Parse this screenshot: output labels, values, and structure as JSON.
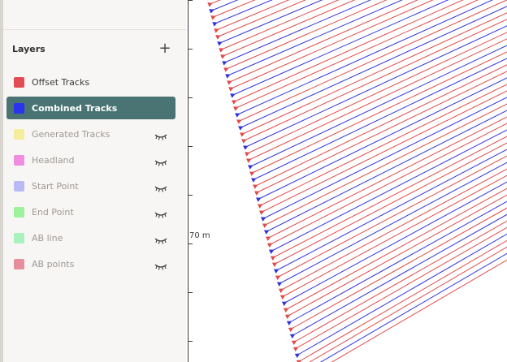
{
  "sidebar": {
    "title": "Layers",
    "add_label": "+",
    "items": [
      {
        "label": "Offset Tracks",
        "color": "#e34b55",
        "selected": false,
        "hidden": false
      },
      {
        "label": "Combined Tracks",
        "color": "#2c33ef",
        "selected": true,
        "hidden": false
      },
      {
        "label": "Generated Tracks",
        "color": "#f4ee9c",
        "selected": false,
        "hidden": true
      },
      {
        "label": "Headland",
        "color": "#f08de0",
        "selected": false,
        "hidden": true
      },
      {
        "label": "Start Point",
        "color": "#b9b9f5",
        "selected": false,
        "hidden": true
      },
      {
        "label": "End Point",
        "color": "#9ff29c",
        "selected": false,
        "hidden": true
      },
      {
        "label": "AB line",
        "color": "#a9f1bf",
        "selected": false,
        "hidden": true
      },
      {
        "label": "AB points",
        "color": "#e68e9b",
        "selected": false,
        "hidden": true
      }
    ]
  },
  "ruler": {
    "label": "70 m"
  },
  "map": {
    "track_colors": {
      "offset": "#e24a4a",
      "combined": "#3333dd"
    },
    "icon_names": {
      "hidden": "eye-closed-icon",
      "add": "plus-icon"
    }
  }
}
